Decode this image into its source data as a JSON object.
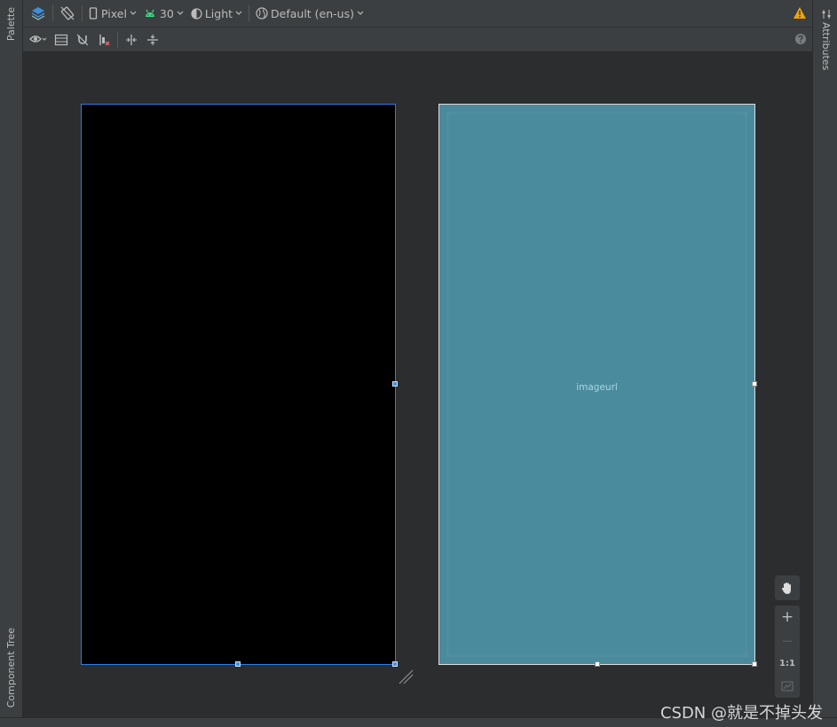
{
  "left_panel": {
    "palette_label": "Palette",
    "component_tree_label": "Component Tree"
  },
  "right_panel": {
    "attributes_label": "Attributes"
  },
  "toolbar": {
    "device_label": "Pixel",
    "api_label": "30",
    "theme_label": "Light",
    "locale_label": "Default (en-us)"
  },
  "blueprint": {
    "image_label": "imageurl"
  },
  "zoom": {
    "zoom_in_label": "+",
    "zoom_out_label": "—",
    "actual_size_label": "1:1"
  },
  "watermark": "CSDN @就是不掉头发",
  "colors": {
    "design_bg": "#000000",
    "blueprint_bg": "#4a8a9c",
    "selection": "#2f7de0",
    "warning": "#f0a30a"
  }
}
